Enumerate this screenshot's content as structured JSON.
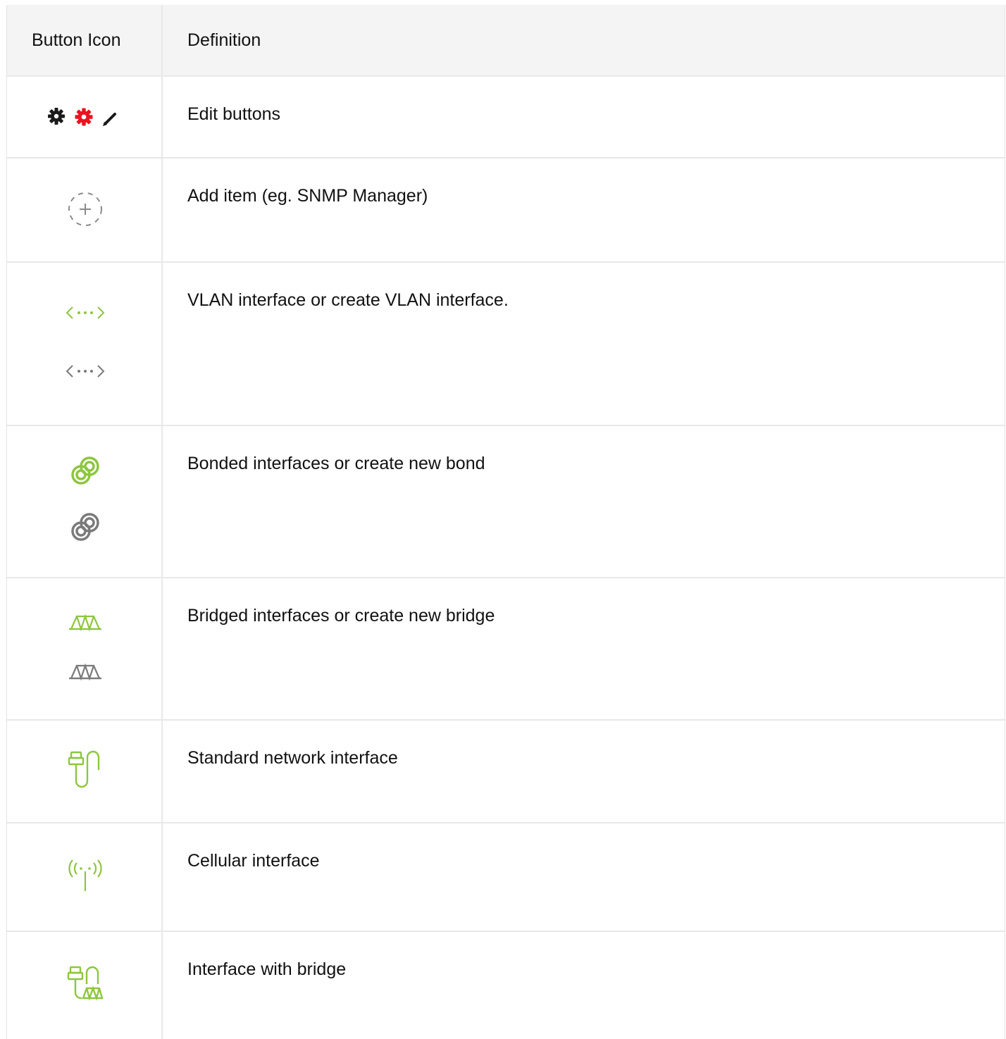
{
  "table": {
    "headers": {
      "icon": "Button Icon",
      "definition": "Definition"
    },
    "rows": [
      {
        "definition": "Edit buttons",
        "icons": [
          "gear-icon",
          "gear-red-icon",
          "pencil-icon"
        ]
      },
      {
        "definition": "Add item (eg. SNMP Manager)",
        "icons": [
          "add-dashed-circle-icon"
        ]
      },
      {
        "definition": "VLAN interface or create VLAN interface.",
        "icons": [
          "vlan-icon-green",
          "vlan-icon-grey"
        ]
      },
      {
        "definition": "Bonded interfaces or create new bond",
        "icons": [
          "bond-icon-green",
          "bond-icon-grey"
        ]
      },
      {
        "definition": "Bridged interfaces or create new bridge",
        "icons": [
          "bridge-icon-green",
          "bridge-icon-grey"
        ]
      },
      {
        "definition": "Standard network interface",
        "icons": [
          "network-cable-icon"
        ]
      },
      {
        "definition": "Cellular interface",
        "icons": [
          "cellular-antenna-icon"
        ]
      },
      {
        "definition": "Interface with bridge",
        "icons": [
          "cable-bridge-icon"
        ]
      }
    ]
  },
  "colors": {
    "green": "#8dc63f",
    "grey": "#7a7a7a",
    "red": "#e8141f",
    "dark": "#1a1a1a",
    "header_bg": "#f4f4f4",
    "border": "#e8e8e8"
  }
}
